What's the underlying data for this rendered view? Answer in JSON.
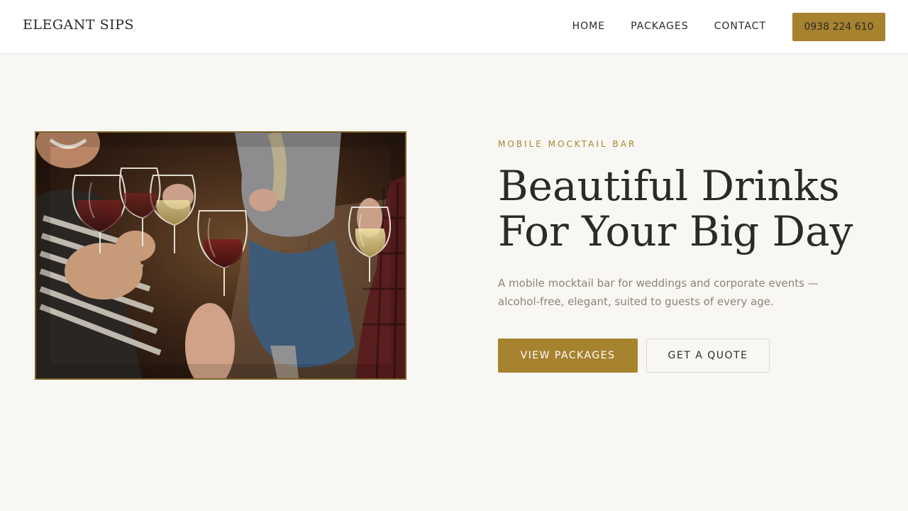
{
  "header": {
    "brand": "ELEGANT SIPS",
    "nav": [
      "HOME",
      "PACKAGES",
      "CONTACT"
    ],
    "phone": "0938 224 610"
  },
  "hero": {
    "image_alt": "Guests toasting with wine glasses",
    "eyebrow": "MOBILE MOCKTAIL BAR",
    "title_lines": [
      "Beautiful Drinks",
      "For Your Big Day"
    ],
    "description_lines": [
      "A mobile mocktail bar for weddings and corporate events —",
      "alcohol-free, elegant, suited to guests of every age."
    ],
    "cta_primary": "VIEW PACKAGES",
    "cta_secondary": "GET A QUOTE"
  },
  "colors": {
    "accent": "#a7822f",
    "page_background": "#f8f7f3",
    "text": "#2b2a27",
    "muted_text": "#8d8475"
  }
}
